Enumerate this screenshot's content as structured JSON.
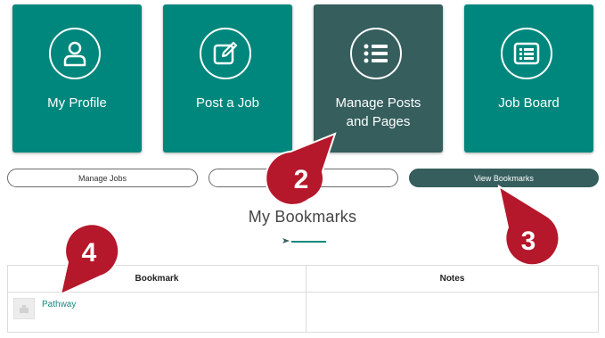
{
  "tiles": [
    {
      "label_lines": [
        "My Profile"
      ],
      "icon": "user-icon"
    },
    {
      "label_lines": [
        "Post a Job"
      ],
      "icon": "edit-icon"
    },
    {
      "label_lines": [
        "Manage Posts",
        "and Pages"
      ],
      "icon": "list-icon"
    },
    {
      "label_lines": [
        "Job Board"
      ],
      "icon": "board-icon"
    }
  ],
  "buttons": {
    "manage_jobs": "Manage Jobs",
    "middle": "",
    "view_bookmarks": "View Bookmarks"
  },
  "heading": "My Bookmarks",
  "table": {
    "headers": [
      "Bookmark",
      "Notes"
    ],
    "rows": [
      {
        "bookmark": "Pathway",
        "notes": ""
      }
    ]
  },
  "callouts": [
    "2",
    "3",
    "4"
  ],
  "colors": {
    "teal": "#00877d",
    "dark_teal": "#355e5d",
    "callout_red": "#b5172b"
  }
}
